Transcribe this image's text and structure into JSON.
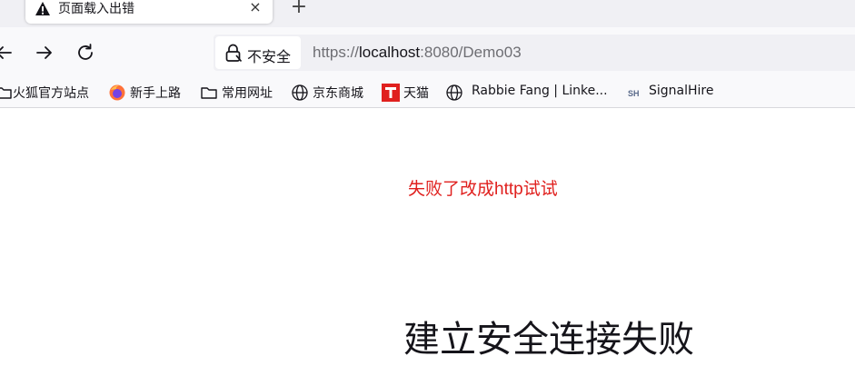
{
  "tab": {
    "title": "页面载入出错",
    "icon": "warning-icon",
    "close_glyph": "×",
    "new_tab_glyph": "+"
  },
  "navbar": {
    "security_label": "不安全",
    "url": {
      "scheme": "https://",
      "host": "localhost",
      "rest": ":8080/Demo03"
    }
  },
  "bookmarks": [
    {
      "label": "火狐官方站点",
      "icon": "folder-icon"
    },
    {
      "label": "新手上路",
      "icon": "firefox-icon"
    },
    {
      "label": "常用网址",
      "icon": "folder-icon"
    },
    {
      "label": "京东商城",
      "icon": "globe-icon"
    },
    {
      "label": "天猫",
      "icon": "tmall-icon"
    },
    {
      "label": "Rabbie Fang | Linke...",
      "icon": "globe-icon"
    },
    {
      "label": "SignalHire",
      "icon": "signalhire-icon"
    }
  ],
  "content": {
    "note": "失败了改成http试试",
    "error_title": "建立安全连接失败"
  },
  "colors": {
    "note_red": "#e0201e",
    "tmall_red": "#e0201e",
    "chrome_bg": "#f9f9fb",
    "urlbar_bg": "#f0f0f4"
  }
}
